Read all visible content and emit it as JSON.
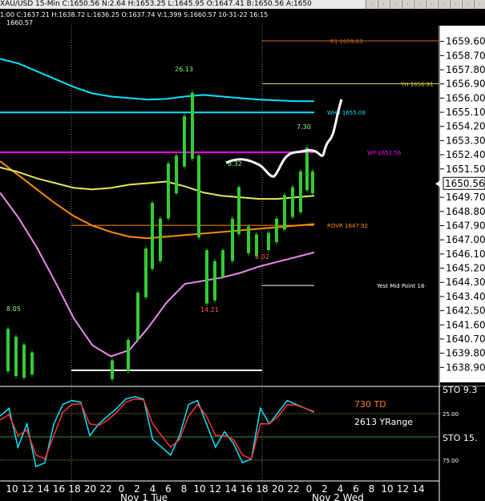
{
  "header": {
    "quote": "XAU/USD 15-Min C:1650.56 N:2.64 H:1653.25 L:1645.95 O:1647.41 B:1650.56 A:1650",
    "indicator_line": "1:00 C:1637.21 H:1638.72 L:1636.25 O:1637.74 V:1,399 S:1660.57 10-31-22 16:15",
    "indicator_value": "1660.57"
  },
  "toolbar_icons": [
    "up-arrow-icon",
    "down-arrow-icon",
    "pencil-icon",
    "crosshair-icon",
    "trend-icon",
    "zoom-icon",
    "cycle-icon",
    "grid-icon",
    "flag-icon",
    "scale-icon"
  ],
  "chart_data": [
    {
      "type": "line",
      "title": "",
      "ylim": [
        1638.0,
        1660.6
      ],
      "y_ticks": [
        "1659.60",
        "1658.70",
        "1657.80",
        "1656.90",
        "1656.00",
        "1655.10",
        "1654.20",
        "1653.30",
        "1652.40",
        "1651.50",
        "1649.70",
        "1648.80",
        "1647.90",
        "1647.00",
        "1646.10",
        "1645.20",
        "1644.30",
        "1643.40",
        "1642.50",
        "1641.60",
        "1640.70",
        "1639.80",
        "1638.90"
      ],
      "last_price": "1650.56",
      "x_ticks": [
        "10",
        "12",
        "14",
        "16",
        "18",
        "20",
        "22",
        "0",
        "2",
        "4",
        "6",
        "8",
        "10",
        "12",
        "14",
        "16",
        "18",
        "20",
        "22",
        "0",
        "2",
        "4",
        "6",
        "8",
        "10",
        "12",
        "14"
      ],
      "date_labels": [
        "Nov 1 Tue",
        "Nov 2 Wed"
      ],
      "levels": [
        {
          "label": "R1 1659.63",
          "value": 1659.63,
          "color": "#d2691e"
        },
        {
          "label": "YH 1656.91",
          "value": 1656.91,
          "color": "#d4d44a"
        },
        {
          "label": "WH3 1655.09",
          "value": 1655.09,
          "color": "#00e5ff"
        },
        {
          "label": "WP 1652.56",
          "value": 1652.56,
          "color": "#ff00ff"
        },
        {
          "label": "ROVR 1647.92",
          "value": 1647.92,
          "color": "#ff8c00"
        },
        {
          "label": "Yest Mid Point 16·",
          "value": 1644.1,
          "color": "#ffffff"
        }
      ],
      "annotations": [
        "26.13",
        "7.30",
        "8.32",
        "5.02",
        "14.21",
        "8.05"
      ],
      "series": [
        {
          "color": "#00e5ff",
          "values": [
            1658.5,
            1658.2,
            1657.7,
            1657.2,
            1656.7,
            1656.3,
            1656.1,
            1656.0,
            1655.9,
            1655.95,
            1656.1,
            1656.2,
            1656.1,
            1656.0,
            1655.9,
            1655.85,
            1655.8,
            1655.8
          ]
        },
        {
          "color": "#ff8c00",
          "values": [
            1652.0,
            1651.1,
            1650.2,
            1649.3,
            1648.5,
            1647.9,
            1647.5,
            1647.2,
            1647.1,
            1647.2,
            1647.3,
            1647.4,
            1647.5,
            1647.6,
            1647.7,
            1647.8,
            1647.9,
            1648.0
          ]
        },
        {
          "color": "#e8e85a",
          "values": [
            1651.6,
            1651.3,
            1650.9,
            1650.6,
            1650.3,
            1650.2,
            1650.3,
            1650.5,
            1650.6,
            1650.7,
            1650.4,
            1650.0,
            1649.8,
            1649.7,
            1649.6,
            1649.6,
            1649.7,
            1649.8
          ]
        },
        {
          "color": "#ee88ee",
          "values": [
            1650.0,
            1648.4,
            1646.5,
            1644.3,
            1642.0,
            1640.3,
            1639.6,
            1640.0,
            1641.4,
            1643.0,
            1644.2,
            1644.4,
            1644.6,
            1644.9,
            1645.3,
            1645.6,
            1645.9,
            1646.2
          ]
        }
      ]
    },
    {
      "type": "line",
      "title": "",
      "labels": [
        "730 TD",
        "2613 YRange",
        "STO 9.3",
        "STO 15."
      ],
      "y_ticks": [
        "25.00",
        "75.00"
      ],
      "series": [
        {
          "color": "#00e5ff",
          "values": [
            30,
            20,
            70,
            40,
            95,
            90,
            40,
            15,
            10,
            12,
            55,
            40,
            30,
            20,
            8,
            5,
            8,
            60,
            70,
            80,
            55,
            15,
            10,
            40,
            70,
            50,
            65,
            90,
            85,
            20,
            40,
            25,
            10,
            15,
            20,
            25
          ]
        },
        {
          "color": "#ff3333",
          "values": [
            35,
            28,
            55,
            48,
            80,
            85,
            55,
            25,
            15,
            14,
            40,
            42,
            35,
            25,
            12,
            8,
            9,
            40,
            55,
            70,
            60,
            30,
            15,
            30,
            55,
            55,
            60,
            80,
            85,
            40,
            40,
            30,
            15,
            16,
            20,
            24
          ]
        }
      ]
    }
  ]
}
